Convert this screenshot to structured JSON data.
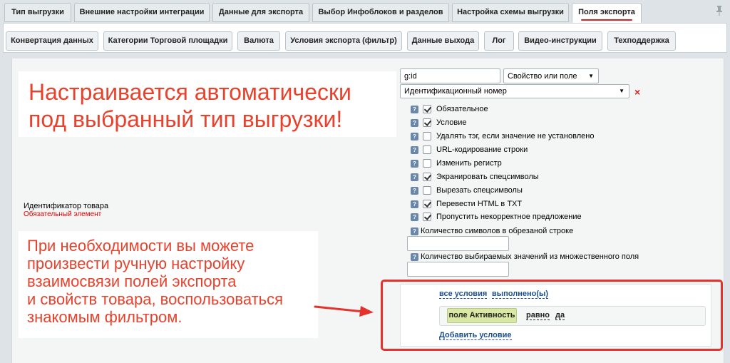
{
  "tabs_main": [
    {
      "label": "Тип выгрузки"
    },
    {
      "label": "Внешние настройки интеграции"
    },
    {
      "label": "Данные для экспорта"
    },
    {
      "label": "Выбор Инфоблоков и разделов"
    },
    {
      "label": "Настройка схемы выгрузки"
    },
    {
      "label": "Поля экспорта",
      "active": true
    }
  ],
  "tabs_sub": [
    {
      "label": "Конвертация данных"
    },
    {
      "label": "Категории Торговой площадки"
    },
    {
      "label": "Валюта"
    },
    {
      "label": "Условия экспорта (фильтр)"
    },
    {
      "label": "Данные выхода"
    },
    {
      "label": "Лог"
    },
    {
      "label": "Видео-инструкции"
    },
    {
      "label": "Техподдержка"
    }
  ],
  "callout_top": {
    "line1": "Настраивается автоматически",
    "line2": "под выбранный тип выгрузки!"
  },
  "callout_bottom": {
    "lines": [
      "При необходимости вы можете",
      "произвести ручную настройку",
      "взаимосвязи полей экспорта",
      "и свойств товара, воспользоваться",
      "знакомым фильтром."
    ]
  },
  "field": {
    "label": "Идентификатор товара",
    "required": "Обязательный элемент"
  },
  "mapping": {
    "tag_value": "g:id",
    "source_type": "Свойство или поле",
    "source_value": "Идентификационный номер",
    "remove_mark": "×"
  },
  "options": [
    {
      "label": "Обязательное",
      "checked": true
    },
    {
      "label": "Условие",
      "checked": true
    },
    {
      "label": "Удалять тэг, если значение не установлено",
      "checked": false
    },
    {
      "label": "URL-кодирование строки",
      "checked": false
    },
    {
      "label": "Изменить регистр",
      "checked": false
    },
    {
      "label": "Экранировать спецсимволы",
      "checked": true
    },
    {
      "label": "Вырезать спецсимволы",
      "checked": false
    },
    {
      "label": "Перевести HTML в TXT",
      "checked": true
    },
    {
      "label": "Пропустить некорректное предложение",
      "checked": true
    }
  ],
  "trim_length": {
    "label": "Количество символов в обрезаной строке",
    "value": ""
  },
  "multi_count": {
    "label": "Количество выбираемых значений из множественного поля",
    "value": ""
  },
  "filter": {
    "all_conditions": "все условия",
    "fulfilled": "выполнено(ы)",
    "field_chip": "поле Активность",
    "operator": "равно",
    "value": "да",
    "add_condition": "Добавить условие"
  },
  "colors": {
    "accent_red": "#e5322d",
    "link_blue": "#1a4f93",
    "chip_green": "#d9e8a4"
  },
  "icons": {
    "pin": "pin-icon",
    "help": "help-icon",
    "arrow": "arrow-right-icon"
  }
}
